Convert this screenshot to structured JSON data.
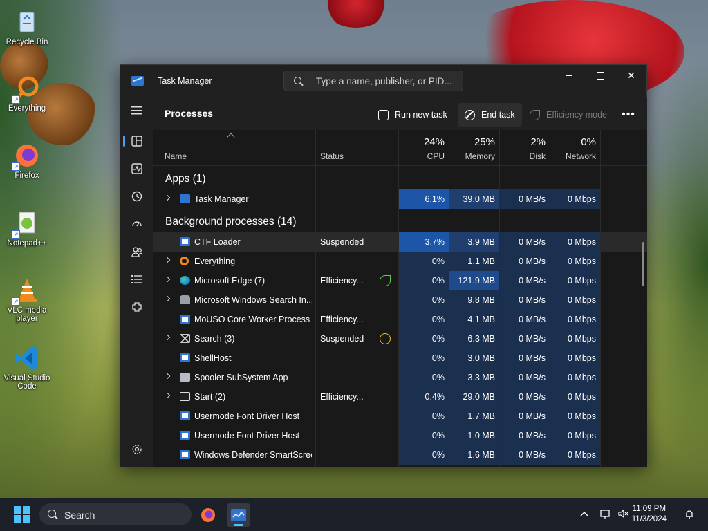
{
  "desktop": {
    "icons": [
      {
        "label": "Recycle Bin",
        "icon": "recycle-bin-icon"
      },
      {
        "label": "Everything",
        "icon": "everything-search-icon"
      },
      {
        "label": "Firefox",
        "icon": "firefox-icon"
      },
      {
        "label": "Notepad++",
        "icon": "notepad-plus-plus-icon"
      },
      {
        "label": "VLC media player",
        "icon": "vlc-icon"
      },
      {
        "label": "Visual Studio Code",
        "icon": "vscode-icon"
      }
    ]
  },
  "window": {
    "title": "Task Manager",
    "search_placeholder": "Type a name, publisher, or PID...",
    "controls": {
      "minimize": "",
      "maximize": "",
      "close": "✕"
    }
  },
  "nav": {
    "items": [
      {
        "name": "processes",
        "icon": "processes-icon"
      },
      {
        "name": "performance",
        "icon": "performance-icon"
      },
      {
        "name": "app-history",
        "icon": "history-icon"
      },
      {
        "name": "startup-apps",
        "icon": "startup-icon"
      },
      {
        "name": "users",
        "icon": "users-icon"
      },
      {
        "name": "details",
        "icon": "details-icon"
      },
      {
        "name": "services",
        "icon": "services-icon"
      }
    ],
    "settings_icon": "gear-icon"
  },
  "toolbar": {
    "page_title": "Processes",
    "run_new_task": "Run new task",
    "end_task": "End task",
    "efficiency_mode": "Efficiency mode",
    "more": "•••"
  },
  "columns": {
    "name": "Name",
    "status": "Status",
    "cpu_pct": "24%",
    "cpu": "CPU",
    "memory_pct": "25%",
    "memory": "Memory",
    "disk_pct": "2%",
    "disk": "Disk",
    "network_pct": "0%",
    "network": "Network"
  },
  "groups": {
    "apps": "Apps (1)",
    "background": "Background processes (14)"
  },
  "apps": [
    {
      "name": "Task Manager",
      "status": "",
      "cpu": "6.1%",
      "memory": "39.0 MB",
      "disk": "0 MB/s",
      "network": "0 Mbps",
      "expandable": true,
      "icon": "task-manager-icon"
    }
  ],
  "background": [
    {
      "name": "CTF Loader",
      "status": "Suspended",
      "cpu": "3.7%",
      "memory": "3.9 MB",
      "disk": "0 MB/s",
      "network": "0 Mbps",
      "expandable": false,
      "icon": "system-window-icon",
      "selected": true
    },
    {
      "name": "Everything",
      "status": "",
      "cpu": "0%",
      "memory": "1.1 MB",
      "disk": "0 MB/s",
      "network": "0 Mbps",
      "expandable": true,
      "icon": "everything-search-icon"
    },
    {
      "name": "Microsoft Edge (7)",
      "status": "Efficiency...",
      "cpu": "0%",
      "memory": "121.9 MB",
      "disk": "0 MB/s",
      "network": "0 Mbps",
      "expandable": true,
      "icon": "edge-icon",
      "badge": "efficiency-leaf-icon"
    },
    {
      "name": "Microsoft Windows Search In...",
      "status": "",
      "cpu": "0%",
      "memory": "9.8 MB",
      "disk": "0 MB/s",
      "network": "0 Mbps",
      "expandable": true,
      "icon": "search-indexer-icon"
    },
    {
      "name": "MoUSO Core Worker Process",
      "status": "Efficiency...",
      "cpu": "0%",
      "memory": "4.1 MB",
      "disk": "0 MB/s",
      "network": "0 Mbps",
      "expandable": false,
      "icon": "system-window-icon"
    },
    {
      "name": "Search (3)",
      "status": "Suspended",
      "cpu": "0%",
      "memory": "6.3 MB",
      "disk": "0 MB/s",
      "network": "0 Mbps",
      "expandable": true,
      "icon": "search-app-icon",
      "badge": "paused-icon"
    },
    {
      "name": "ShellHost",
      "status": "",
      "cpu": "0%",
      "memory": "3.0 MB",
      "disk": "0 MB/s",
      "network": "0 Mbps",
      "expandable": false,
      "icon": "system-window-icon"
    },
    {
      "name": "Spooler SubSystem App",
      "status": "",
      "cpu": "0%",
      "memory": "3.3 MB",
      "disk": "0 MB/s",
      "network": "0 Mbps",
      "expandable": true,
      "icon": "printer-icon"
    },
    {
      "name": "Start (2)",
      "status": "Efficiency...",
      "cpu": "0.4%",
      "memory": "29.0 MB",
      "disk": "0 MB/s",
      "network": "0 Mbps",
      "expandable": true,
      "icon": "start-window-icon"
    },
    {
      "name": "Usermode Font Driver Host",
      "status": "",
      "cpu": "0%",
      "memory": "1.7 MB",
      "disk": "0 MB/s",
      "network": "0 Mbps",
      "expandable": false,
      "icon": "system-window-icon"
    },
    {
      "name": "Usermode Font Driver Host",
      "status": "",
      "cpu": "0%",
      "memory": "1.0 MB",
      "disk": "0 MB/s",
      "network": "0 Mbps",
      "expandable": false,
      "icon": "system-window-icon"
    },
    {
      "name": "Windows Defender SmartScreen",
      "status": "",
      "cpu": "0%",
      "memory": "1.6 MB",
      "disk": "0 MB/s",
      "network": "0 Mbps",
      "expandable": false,
      "icon": "system-window-icon"
    }
  ],
  "taskbar": {
    "search_label": "Search",
    "time": "11:09 PM",
    "date": "11/3/2024",
    "accent": "#4cc2ff"
  }
}
